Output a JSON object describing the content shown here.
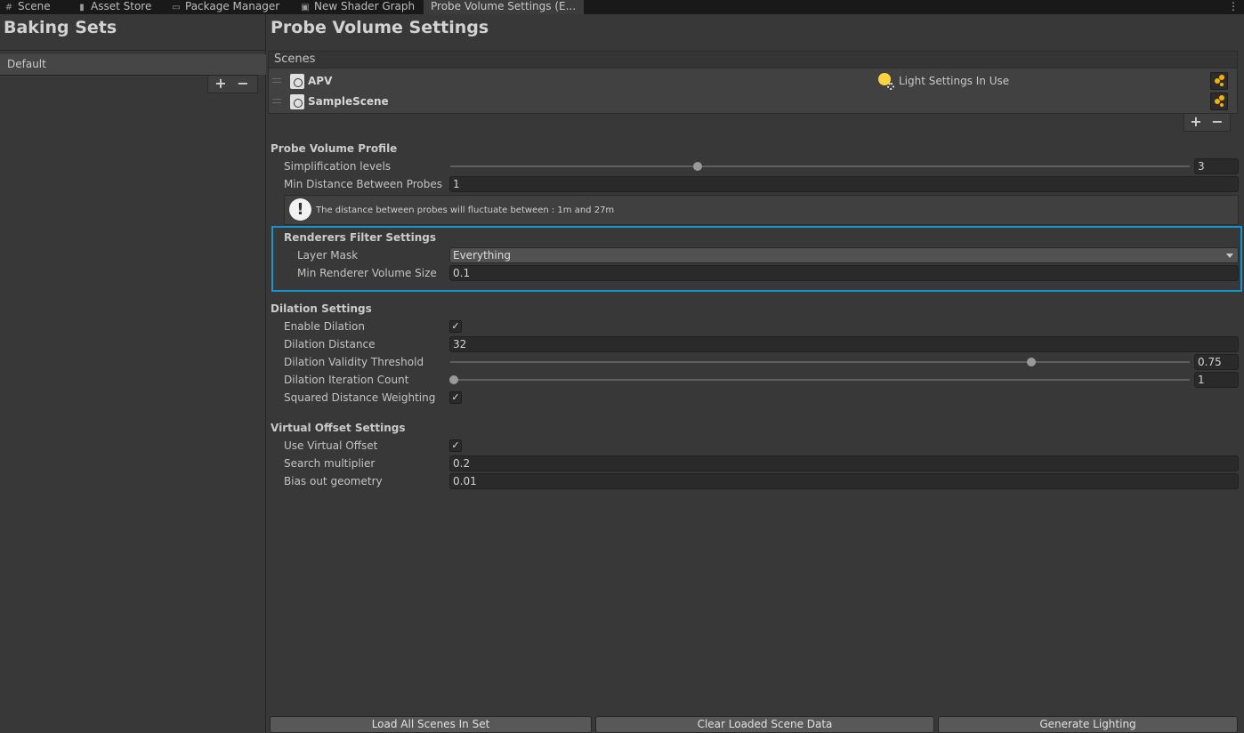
{
  "tabs": [
    {
      "label": "Scene",
      "icon": "grid-icon"
    },
    {
      "label": "Asset Store",
      "icon": "store-icon"
    },
    {
      "label": "Package Manager",
      "icon": "package-icon"
    },
    {
      "label": "New Shader Graph",
      "icon": "shadergraph-icon"
    },
    {
      "label": "Probe Volume Settings (E...",
      "icon": ""
    }
  ],
  "tab_menu_icon": "⋮",
  "left_panel": {
    "title": "Baking Sets",
    "items": [
      "Default"
    ],
    "add_label": "+",
    "remove_label": "−"
  },
  "right_panel": {
    "title": "Probe Volume Settings",
    "scenes": {
      "header": "Scenes",
      "rows": [
        {
          "name": "APV",
          "status": "Light Settings In Use"
        },
        {
          "name": "SampleScene",
          "status": ""
        }
      ],
      "add_label": "+",
      "remove_label": "−"
    },
    "probe_volume_profile": {
      "header": "Probe Volume Profile",
      "simplification_label": "Simplification levels",
      "simplification_value": "3",
      "simplification_fraction": 0.33,
      "min_distance_label": "Min Distance Between Probes",
      "min_distance_value": "1",
      "help_text": "The distance between probes will fluctuate between : 1m and 27m"
    },
    "renderers_filter": {
      "header": "Renderers Filter Settings",
      "layer_mask_label": "Layer Mask",
      "layer_mask_value": "Everything",
      "min_volume_label": "Min Renderer Volume Size",
      "min_volume_value": "0.1"
    },
    "dilation": {
      "header": "Dilation Settings",
      "enable_label": "Enable Dilation",
      "enable_checked": true,
      "distance_label": "Dilation Distance",
      "distance_value": "32",
      "validity_label": "Dilation Validity Threshold",
      "validity_value": "0.75",
      "iteration_label": "Dilation Iteration Count",
      "iteration_value": "1",
      "squared_label": "Squared Distance Weighting",
      "squared_checked": true
    },
    "virtual_offset": {
      "header": "Virtual Offset Settings",
      "use_label": "Use Virtual Offset",
      "use_checked": true,
      "search_label": "Search multiplier",
      "search_value": "0.2",
      "bias_label": "Bias out geometry",
      "bias_value": "0.01"
    },
    "buttons": {
      "load_all": "Load All Scenes In Set",
      "clear": "Clear Loaded Scene Data",
      "generate": "Generate Lighting"
    }
  },
  "colors": {
    "highlight": "#1793d1",
    "bulb": "#ffd43b",
    "scene_button": "#f5b000"
  }
}
